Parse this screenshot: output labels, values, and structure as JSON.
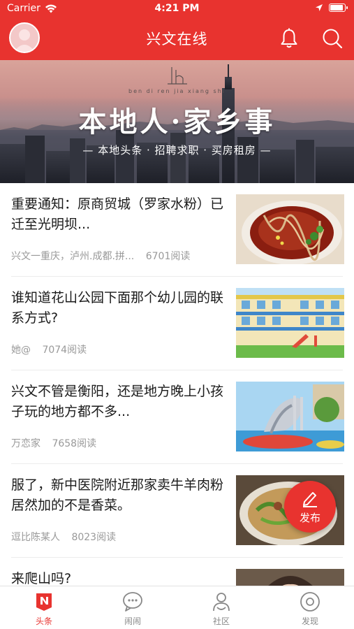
{
  "status_bar": {
    "carrier": "Carrier",
    "time": "4:21 PM"
  },
  "nav": {
    "title": "兴文在线"
  },
  "banner": {
    "pinyin": "ben di ren jia xiang shi",
    "title": "本地人·家乡事",
    "subtitle": "— 本地头条 · 招聘求职 · 买房租房 —"
  },
  "feed": [
    {
      "title": "重要通知：原商贸城（罗家水粉）已迁至光明坝...",
      "source": "兴文一重庆，泸州.成都.拼...",
      "reads": "6701阅读",
      "thumb": "noodle-photo"
    },
    {
      "title": "谁知道花山公园下面那个幼儿园的联系方式?",
      "source": "她@",
      "reads": "7074阅读",
      "thumb": "kindergarten-photo"
    },
    {
      "title": "兴文不管是衡阳，还是地方晚上小孩子玩的地方都不多...",
      "source": "万恋家",
      "reads": "7658阅读",
      "thumb": "playground-photo"
    },
    {
      "title": "服了，新中医院附近那家卖牛羊肉粉居然加的不是香菜。",
      "source": "逗比陈某人",
      "reads": "8023阅读",
      "thumb": "beef-noodle-photo"
    },
    {
      "title": "来爬山吗?",
      "source": "",
      "reads": "",
      "thumb": "portrait-photo"
    }
  ],
  "fab": {
    "label": "发布",
    "icon": "pencil-icon"
  },
  "tabs": [
    {
      "label": "头条",
      "icon": "news-n-icon",
      "active": true
    },
    {
      "label": "闹闹",
      "icon": "chat-bubble-icon",
      "active": false
    },
    {
      "label": "社区",
      "icon": "community-icon",
      "active": false
    },
    {
      "label": "发现",
      "icon": "discover-icon",
      "active": false
    }
  ],
  "colors": {
    "brand": "#e8332f",
    "text": "#1a1a1a",
    "meta": "#999999"
  }
}
